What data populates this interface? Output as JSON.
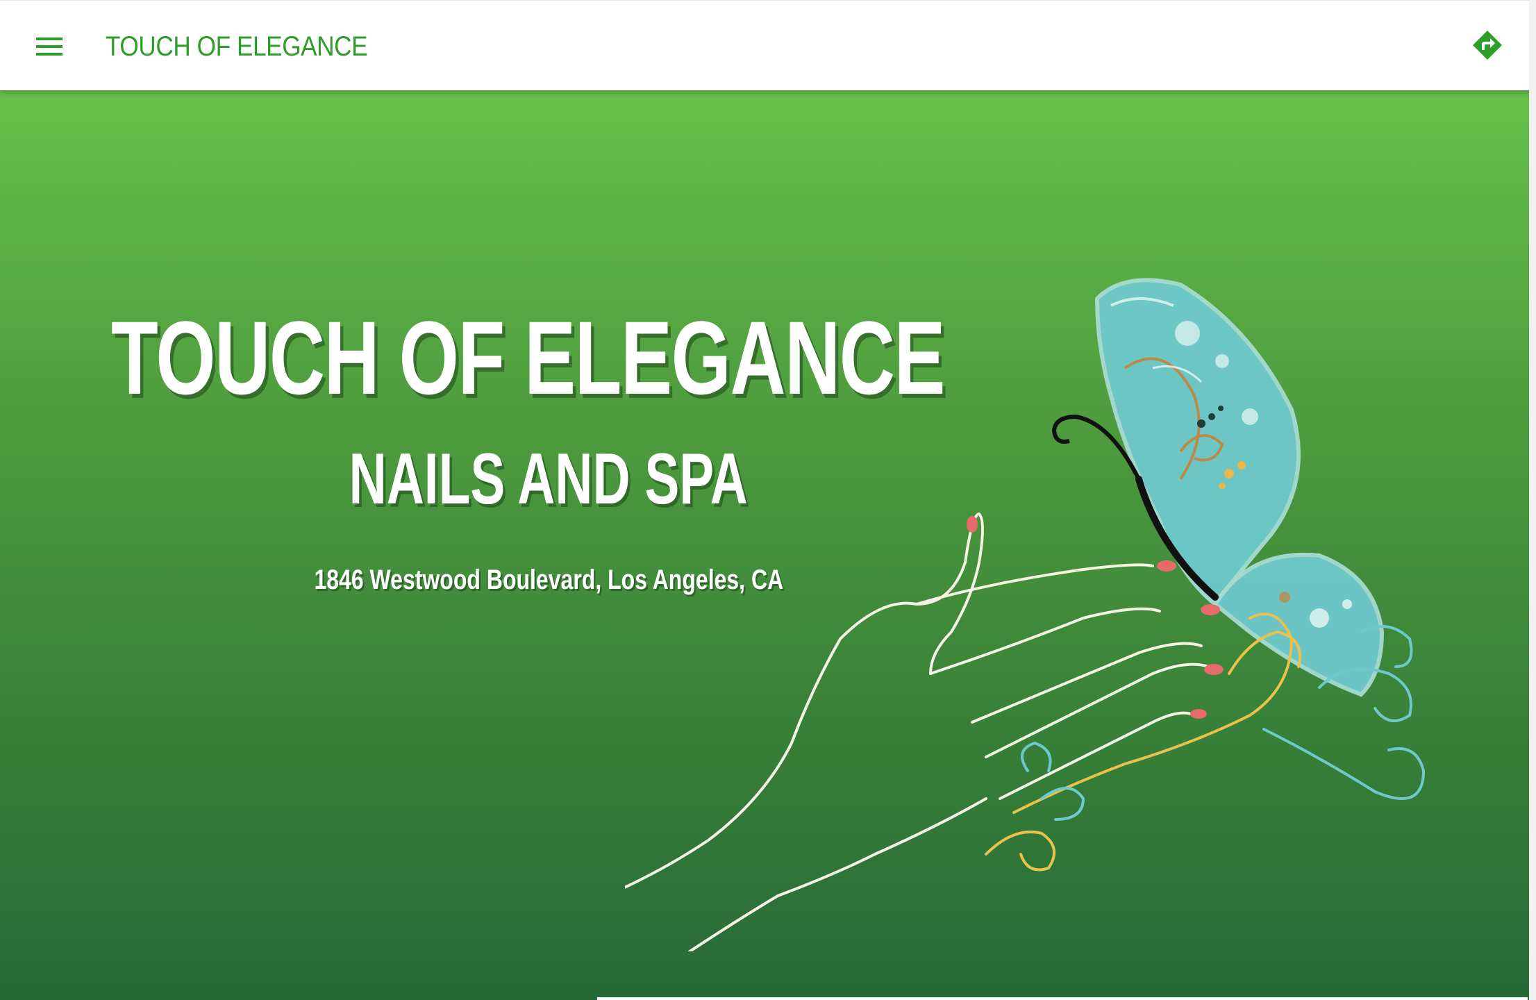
{
  "appbar": {
    "brand": "TOUCH OF ELEGANCE",
    "brand_color": "#2e9e2a",
    "menu_icon": "menu-icon",
    "directions_icon": "directions-icon"
  },
  "hero": {
    "title": "TOUCH OF ELEGANCE",
    "subtitle": "NAILS AND SPA",
    "address": "1846 Westwood Boulevard, Los Angeles, CA",
    "gradient_top": "#68c04a",
    "gradient_bottom": "#276937",
    "illustration": "butterfly-on-hand-illustration"
  }
}
